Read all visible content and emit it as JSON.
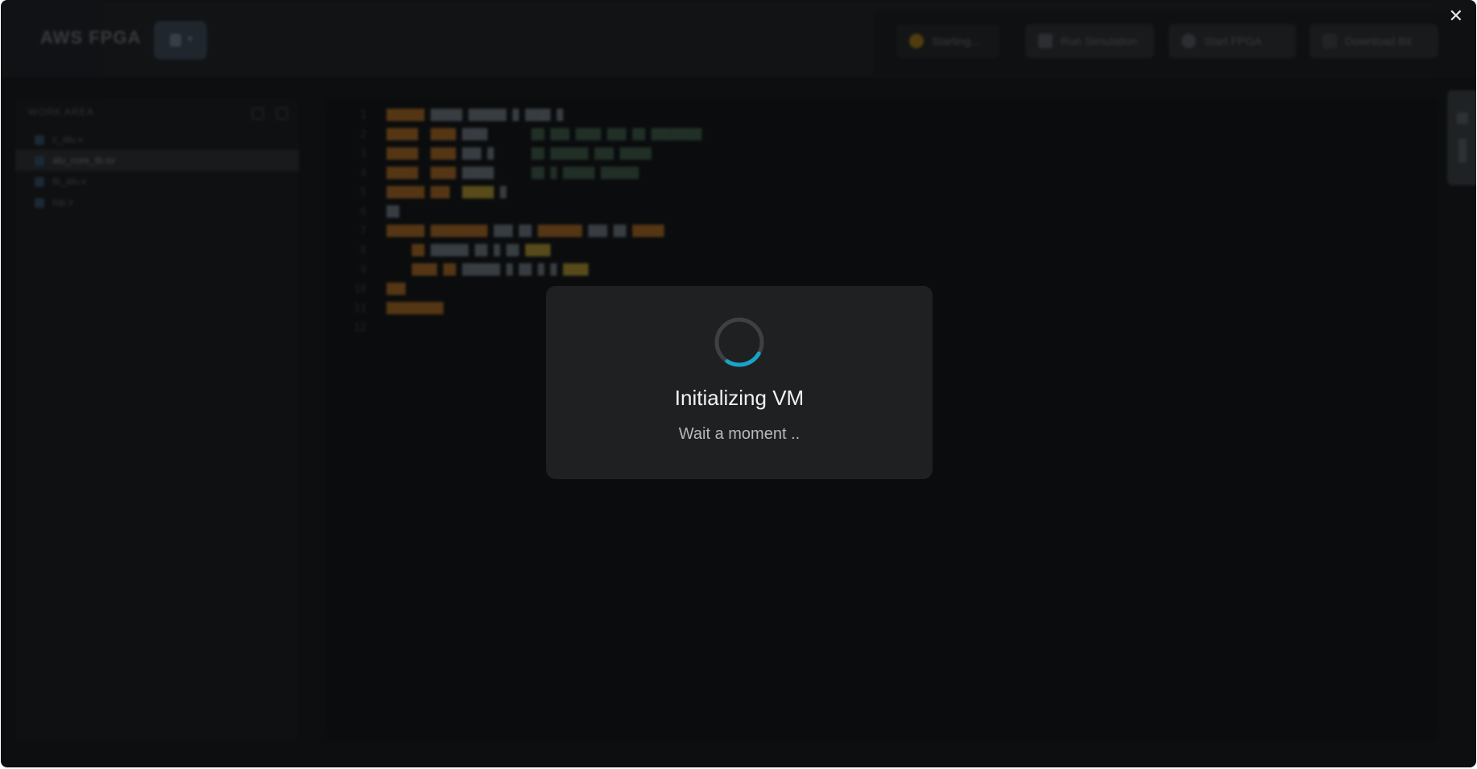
{
  "window": {
    "close_label": "✕"
  },
  "header": {
    "app_title": "AWS FPGA",
    "status_pill": {
      "label": "Starting...",
      "color": "#a8790f"
    },
    "actions": [
      {
        "label": "Run Simulation",
        "icon": "play-icon"
      },
      {
        "label": "Start FPGA",
        "icon": "power-icon"
      },
      {
        "label": "Download Bit",
        "icon": "download-icon"
      }
    ]
  },
  "sidebar": {
    "header": "WORK AREA",
    "files": [
      {
        "name": "c_alu.v",
        "active": false
      },
      {
        "name": "alu_core_tb.sv",
        "active": true
      },
      {
        "name": "tb_alu.v",
        "active": false
      },
      {
        "name": "top.v",
        "active": false
      }
    ]
  },
  "editor": {
    "line_numbers": [
      "1",
      "2",
      "3",
      "4",
      "5",
      "6",
      "7",
      "8",
      "9",
      "10",
      "11",
      "12"
    ]
  },
  "modal": {
    "title": "Initializing VM",
    "subtitle": "Wait a moment  ..",
    "spinner_track_color": "#3e4144",
    "spinner_arc_color": "#1aa3c9"
  }
}
